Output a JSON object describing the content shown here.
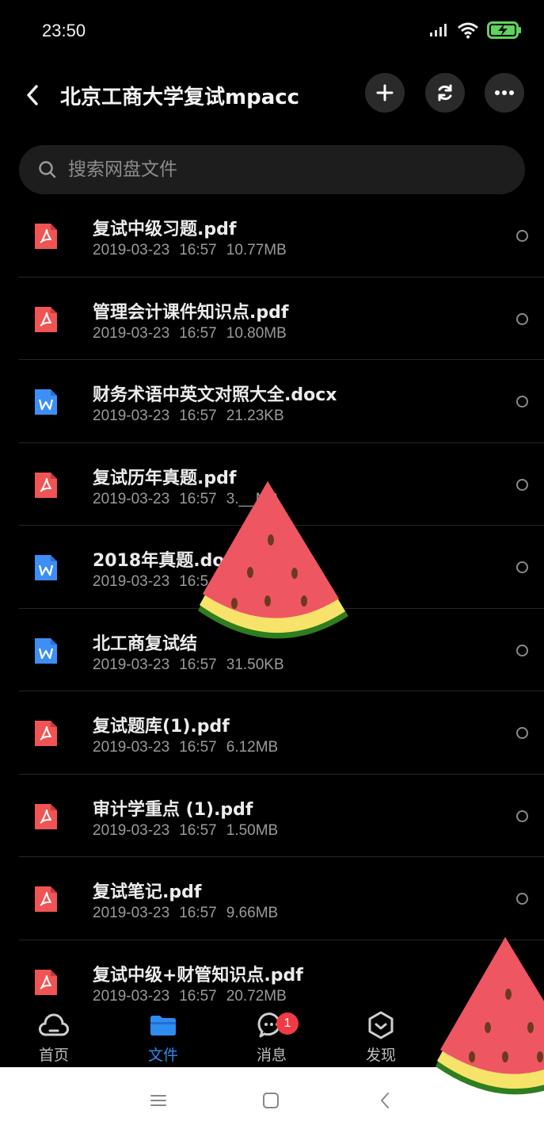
{
  "status": {
    "time": "23:50"
  },
  "header": {
    "title": "北京工商大学复试mpacc"
  },
  "search": {
    "placeholder": "搜索网盘文件"
  },
  "files": [
    {
      "name": "复试中级习题.pdf",
      "date": "2019-03-23",
      "time": "16:57",
      "size": "10.77MB",
      "type": "pdf"
    },
    {
      "name": "管理会计课件知识点.pdf",
      "date": "2019-03-23",
      "time": "16:57",
      "size": "10.80MB",
      "type": "pdf"
    },
    {
      "name": "财务术语中英文对照大全.docx",
      "date": "2019-03-23",
      "time": "16:57",
      "size": "21.23KB",
      "type": "doc"
    },
    {
      "name": "复试历年真题.pdf",
      "date": "2019-03-23",
      "time": "16:57",
      "size": "3.__MB",
      "type": "pdf"
    },
    {
      "name": "2018年真题.doc",
      "date": "2019-03-23",
      "time": "16:5",
      "size": "",
      "type": "doc"
    },
    {
      "name": "北工商复试结",
      "date": "2019-03-23",
      "time": "16:57",
      "size": "31.50KB",
      "type": "doc"
    },
    {
      "name": "复试题库(1).pdf",
      "date": "2019-03-23",
      "time": "16:57",
      "size": "6.12MB",
      "type": "pdf"
    },
    {
      "name": "审计学重点 (1).pdf",
      "date": "2019-03-23",
      "time": "16:57",
      "size": "1.50MB",
      "type": "pdf"
    },
    {
      "name": "复试笔记.pdf",
      "date": "2019-03-23",
      "time": "16:57",
      "size": "9.66MB",
      "type": "pdf"
    },
    {
      "name": "复试中级+财管知识点.pdf",
      "date": "2019-03-23",
      "time": "16:57",
      "size": "20.72MB",
      "type": "pdf"
    }
  ],
  "tabs": [
    {
      "label": "首页",
      "icon": "cloud-icon",
      "active": false
    },
    {
      "label": "文件",
      "icon": "folder-icon",
      "active": true
    },
    {
      "label": "消息",
      "icon": "chat-icon",
      "active": false,
      "badge": "1"
    },
    {
      "label": "发现",
      "icon": "discover-icon",
      "active": false
    }
  ],
  "colors": {
    "accent": "#2f8cf0",
    "pdf": "#f05454",
    "doc": "#3d8ef5",
    "badge": "#f03a45"
  }
}
